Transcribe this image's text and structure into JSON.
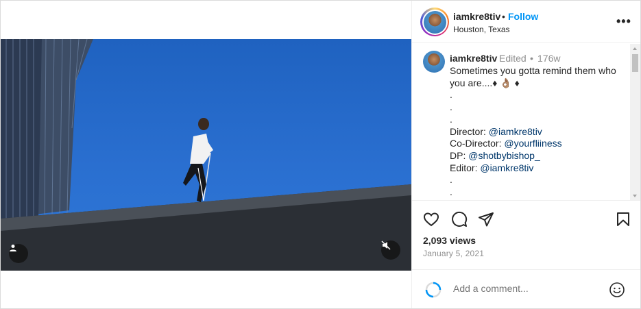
{
  "post": {
    "username": "iamkre8tiv",
    "follow_label": "Follow",
    "separator": "•",
    "location": "Houston, Texas",
    "more_label": "•••"
  },
  "caption": {
    "username": "iamkre8tiv",
    "edited_label": "Edited",
    "separator": "•",
    "age": "176w",
    "line1": "Sometimes you gotta remind them who",
    "line2": "you are....♦ 👌🏽 ♦",
    "dot": ".",
    "director_label": "Director: ",
    "director_handle": "@iamkre8tiv",
    "codirector_label": "Co-Director: ",
    "codirector_handle": "@yourfliiness",
    "dp_label": "DP: ",
    "dp_handle": "@shotbybishop_",
    "editor_label": "Editor: ",
    "editor_handle": "@iamkre8tiv"
  },
  "stats": {
    "views": "2,093 views",
    "date": "January 5, 2021"
  },
  "comment": {
    "placeholder": "Add a comment..."
  },
  "icons": {
    "like": "heart-icon",
    "comment": "comment-icon",
    "share": "paper-plane-icon",
    "save": "bookmark-icon",
    "emoji": "smiley-icon",
    "user_tag": "user-icon",
    "mute": "speaker-muted-icon"
  },
  "colors": {
    "accent": "#0095f6",
    "mention": "#00376b",
    "muted_text": "#8e8e8e",
    "sky": "#2a6fd0"
  }
}
